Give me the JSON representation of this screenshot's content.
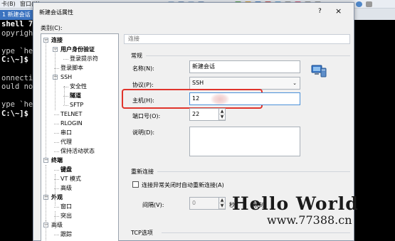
{
  "background": {
    "menu_items": [
      "卡(B)",
      "窗口(W",
      "..."
    ],
    "tab_label": "1 新建会话",
    "terminal_lines": [
      {
        "text": "shell 7",
        "cls": "s"
      },
      {
        "text": "opyrigh",
        "cls": ""
      },
      {
        "text": "",
        "cls": ""
      },
      {
        "text": "ype `he",
        "cls": ""
      },
      {
        "text": "C:\\~]$",
        "cls": "p"
      },
      {
        "text": "",
        "cls": ""
      },
      {
        "text": "onnecti",
        "cls": ""
      },
      {
        "text": "ould no",
        "cls": ""
      },
      {
        "text": "",
        "cls": ""
      },
      {
        "text": "ype `he",
        "cls": ""
      },
      {
        "text": "C:\\~]$",
        "cls": "p"
      }
    ]
  },
  "dialog": {
    "title": "新建会话属性",
    "help": "?",
    "close": "×",
    "category_label": "类别(C):",
    "tree": [
      {
        "label": "连接",
        "bold": true,
        "level": 0,
        "toggle": "−"
      },
      {
        "label": "用户身份验证",
        "bold": true,
        "level": 1,
        "toggle": "−"
      },
      {
        "label": "登录提示符",
        "bold": false,
        "level": 2,
        "toggle": ""
      },
      {
        "label": "登录脚本",
        "bold": false,
        "level": 1,
        "toggle": ""
      },
      {
        "label": "SSH",
        "bold": false,
        "level": 1,
        "toggle": "−"
      },
      {
        "label": "安全性",
        "bold": false,
        "level": 2,
        "toggle": ""
      },
      {
        "label": "隧道",
        "bold": true,
        "level": 2,
        "toggle": ""
      },
      {
        "label": "SFTP",
        "bold": false,
        "level": 2,
        "toggle": ""
      },
      {
        "label": "TELNET",
        "bold": false,
        "level": 1,
        "toggle": ""
      },
      {
        "label": "RLOGIN",
        "bold": false,
        "level": 1,
        "toggle": ""
      },
      {
        "label": "串口",
        "bold": false,
        "level": 1,
        "toggle": ""
      },
      {
        "label": "代理",
        "bold": false,
        "level": 1,
        "toggle": ""
      },
      {
        "label": "保持活动状态",
        "bold": false,
        "level": 1,
        "toggle": ""
      },
      {
        "label": "终端",
        "bold": true,
        "level": 0,
        "toggle": "−"
      },
      {
        "label": "键盘",
        "bold": true,
        "level": 1,
        "toggle": ""
      },
      {
        "label": "VT 模式",
        "bold": false,
        "level": 1,
        "toggle": ""
      },
      {
        "label": "高级",
        "bold": false,
        "level": 1,
        "toggle": ""
      },
      {
        "label": "外观",
        "bold": true,
        "level": 0,
        "toggle": "−"
      },
      {
        "label": "窗口",
        "bold": false,
        "level": 1,
        "toggle": ""
      },
      {
        "label": "突出",
        "bold": false,
        "level": 1,
        "toggle": ""
      },
      {
        "label": "高级",
        "bold": false,
        "level": 0,
        "toggle": "−"
      },
      {
        "label": "跟踪",
        "bold": false,
        "level": 1,
        "toggle": ""
      }
    ],
    "section_header": "连接",
    "general": {
      "group_label": "常规",
      "name_label": "名称(N):",
      "name_value": "新建会话",
      "protocol_label": "协议(P):",
      "protocol_value": "SSH",
      "host_label": "主机(H):",
      "host_value": "12",
      "port_label": "端口号(O):",
      "port_value": "22",
      "desc_label": "说明(D):",
      "desc_value": ""
    },
    "reconnect": {
      "group_label": "重新连接",
      "auto_reconnect_label": "连接异常关闭时自动重新连接(A)",
      "interval_label": "间隔(V):",
      "interval_value": "0",
      "seconds_unit": "秒",
      "limit_label": "限制"
    },
    "tcp": {
      "group_label": "TCP选项"
    }
  },
  "watermark": {
    "title": "Hello World",
    "url": "www.77388.cn"
  }
}
